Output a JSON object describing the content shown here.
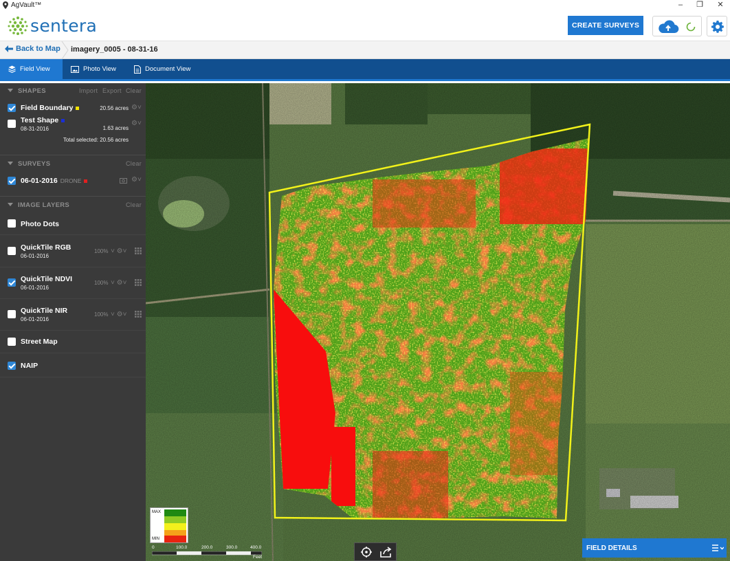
{
  "window": {
    "title": "AgVault™",
    "controls": [
      "–",
      "❐",
      "✕"
    ]
  },
  "header": {
    "logo_text": "sentera",
    "create_button": "CREATE SURVEYS"
  },
  "breadcrumb": {
    "back_label": "Back to Map",
    "title": "imagery_0005 - 08-31-16"
  },
  "tabs": [
    {
      "label": "Field View",
      "icon": "layers-icon",
      "active": true
    },
    {
      "label": "Photo View",
      "icon": "photo-icon",
      "active": false
    },
    {
      "label": "Document View",
      "icon": "document-icon",
      "active": false
    }
  ],
  "sidebar": {
    "shapes": {
      "heading": "SHAPES",
      "actions": [
        "Import",
        "Export",
        "Clear"
      ],
      "items": [
        {
          "name": "Field Boundary",
          "date": "",
          "acres": "20.56 acres",
          "checked": true,
          "color": "#f5e400"
        },
        {
          "name": "Test Shape",
          "date": "08-31-2016",
          "acres": "1.63 acres",
          "checked": false,
          "color": "#1b2fd6"
        }
      ],
      "total": "Total selected: 20.56 acres"
    },
    "surveys": {
      "heading": "SURVEYS",
      "action": "Clear",
      "items": [
        {
          "name": "06-01-2016",
          "tag": "DRONE",
          "checked": true,
          "color": "#e02020"
        }
      ]
    },
    "image_layers": {
      "heading": "IMAGE LAYERS",
      "action": "Clear",
      "items": [
        {
          "name": "Photo Dots",
          "date": "",
          "opacity": "",
          "checked": false
        },
        {
          "name": "QuickTile RGB",
          "date": "06-01-2016",
          "opacity": "100%",
          "checked": false
        },
        {
          "name": "QuickTile NDVI",
          "date": "06-01-2016",
          "opacity": "100%",
          "checked": true
        },
        {
          "name": "QuickTile NIR",
          "date": "06-01-2016",
          "opacity": "100%",
          "checked": false
        },
        {
          "name": "Street Map",
          "date": "",
          "opacity": "",
          "checked": false
        },
        {
          "name": "NAIP",
          "date": "",
          "opacity": "",
          "checked": true
        }
      ]
    }
  },
  "map": {
    "legend": {
      "max_label": "MAX",
      "min_label": "MIN",
      "colors": [
        "#1f8a12",
        "#8fca24",
        "#f3f01c",
        "#f5a21a",
        "#e82410"
      ]
    },
    "scale": {
      "ticks": [
        "0",
        "100.0",
        "200.0",
        "300.0",
        "400.0"
      ],
      "unit": "Feet"
    },
    "tools": [
      "recenter-icon",
      "share-icon"
    ],
    "field_details_label": "FIELD DETAILS",
    "boundary_color": "#f2f21a"
  }
}
